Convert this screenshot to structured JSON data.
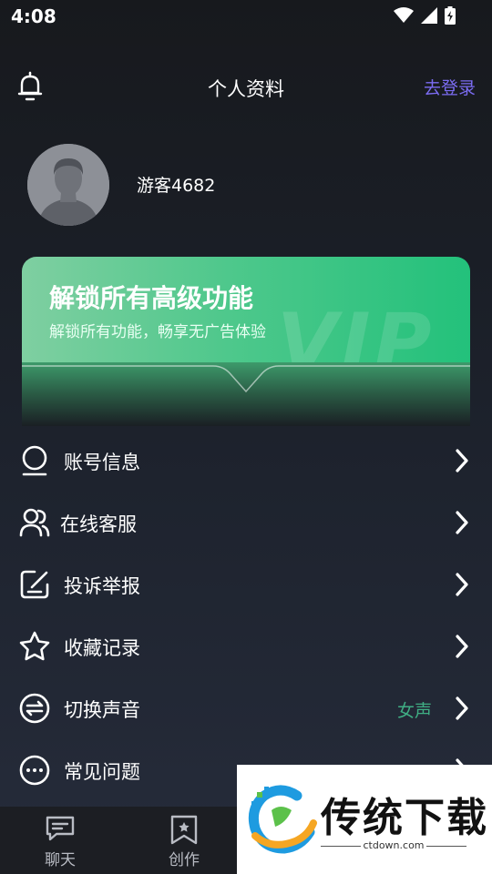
{
  "status_bar": {
    "time": "4:08"
  },
  "header": {
    "title": "个人资料",
    "login_label": "去登录"
  },
  "profile": {
    "username": "游客4682"
  },
  "vip_banner": {
    "title": "解锁所有高级功能",
    "subtitle": "解锁所有功能，畅享无广告体验",
    "watermark": "VIP"
  },
  "menu": {
    "items": [
      {
        "label": "账号信息",
        "icon": "user-icon"
      },
      {
        "label": "在线客服",
        "icon": "users-icon"
      },
      {
        "label": "投诉举报",
        "icon": "edit-icon"
      },
      {
        "label": "收藏记录",
        "icon": "star-icon"
      },
      {
        "label": "切换声音",
        "icon": "switch-icon",
        "value": "女声"
      },
      {
        "label": "常见问题",
        "icon": "more-icon"
      }
    ]
  },
  "tab_bar": {
    "items": [
      {
        "label": "聊天",
        "icon": "chat-icon"
      },
      {
        "label": "创作",
        "icon": "bookmark-icon"
      }
    ]
  },
  "overlay_watermark": {
    "brand": "传统下载",
    "url": "ctdown.com"
  },
  "colors": {
    "accent": "#7b6cf2",
    "vip_green": "#23c17b",
    "value_green": "#3fae84"
  }
}
